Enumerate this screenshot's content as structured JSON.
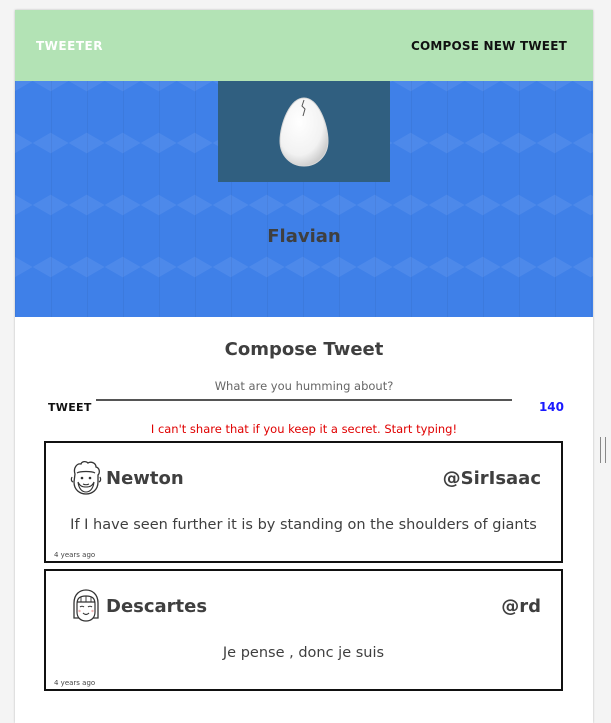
{
  "navbar": {
    "brand": "TWEETER",
    "compose_link": "COMPOSE NEW TWEET"
  },
  "profile": {
    "avatar_icon": "egg-icon",
    "name": "Flavian"
  },
  "composer": {
    "title": "Compose Tweet",
    "placeholder": "What are you humming about?",
    "value": "",
    "submit_label": "TWEET",
    "counter": "140",
    "error": "I can't share that if you keep it a secret. Start typing!"
  },
  "tweets": [
    {
      "avatar_icon": "bearded-man-avatar-icon",
      "name": "Newton",
      "handle": "@SirIsaac",
      "text": "If I have seen further it is by standing on the shoulders of giants",
      "timestamp": "4 years ago"
    },
    {
      "avatar_icon": "bob-haircut-avatar-icon",
      "name": "Descartes",
      "handle": "@rd",
      "text": "Je pense , donc je suis",
      "timestamp": "4 years ago"
    }
  ],
  "colors": {
    "navbar_bg": "#b3e3b5",
    "hero_bg": "#3f80e8",
    "avatar_box_bg": "#305f80",
    "counter": "#1a1aff",
    "error": "#e00000"
  }
}
